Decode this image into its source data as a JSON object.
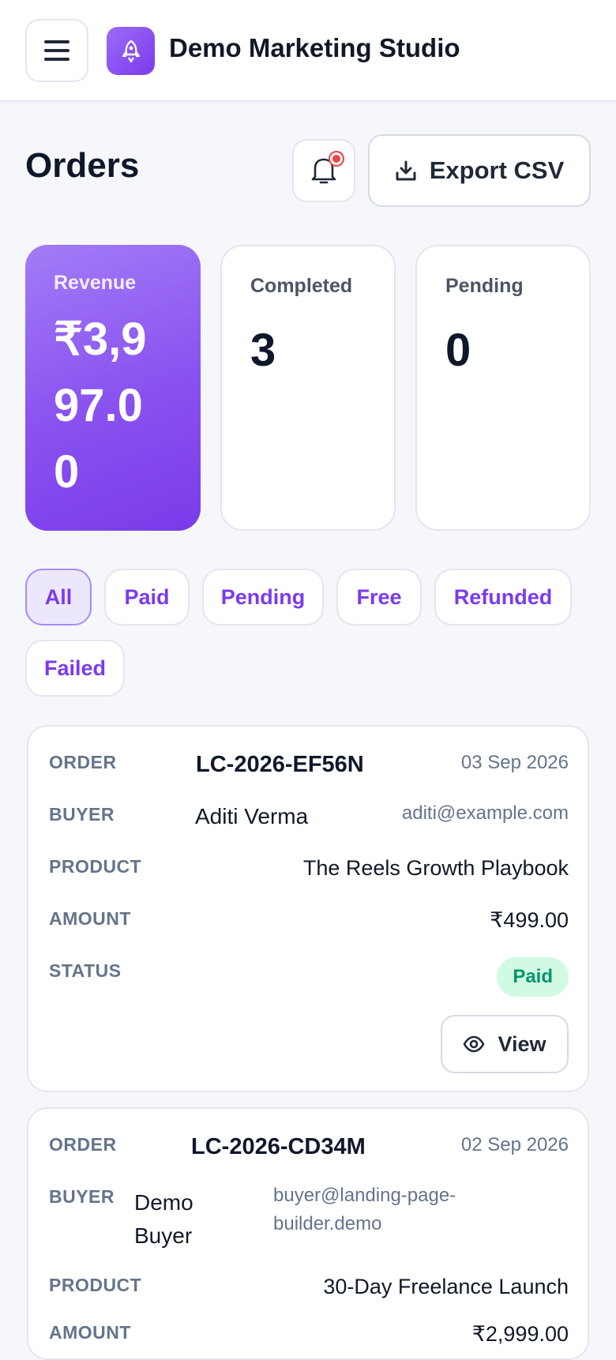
{
  "header": {
    "menu_icon": "hamburger-menu-icon",
    "logo_icon": "rocket-icon",
    "brand_name": "Demo Marketing Studio"
  },
  "page": {
    "title": "Orders",
    "bell_icon": "bell-icon",
    "export_icon": "download-icon",
    "export_label": "Export CSV"
  },
  "stats": {
    "revenue_label": "Revenue",
    "revenue_value": "₹3,997.00",
    "completed_label": "Completed",
    "completed_value": "3",
    "pending_label": "Pending",
    "pending_value": "0"
  },
  "filters": {
    "all": "All",
    "paid": "Paid",
    "pending": "Pending",
    "free": "Free",
    "refunded": "Refunded",
    "failed": "Failed",
    "active": "All"
  },
  "labels": {
    "order": "ORDER",
    "buyer": "BUYER",
    "product": "PRODUCT",
    "amount": "AMOUNT",
    "status": "STATUS"
  },
  "orders": [
    {
      "id": "LC-2026-EF56N",
      "date": "03 Sep 2026",
      "buyer_name": "Aditi Verma",
      "buyer_email": "aditi@example.com",
      "product": "The Reels Growth Playbook",
      "amount": "₹499.00",
      "status": "Paid",
      "view_label": "View"
    },
    {
      "id": "LC-2026-CD34M",
      "date": "02 Sep 2026",
      "buyer_name": "Demo Buyer",
      "buyer_email": "buyer@landing-page-builder.demo",
      "product": "30-Day Freelance Launch",
      "amount": "₹2,999.00"
    }
  ],
  "colors": {
    "accent": "#7c3aed",
    "paid_bg": "#d1fae5",
    "paid_text": "#059669",
    "notification": "#ef4444"
  }
}
